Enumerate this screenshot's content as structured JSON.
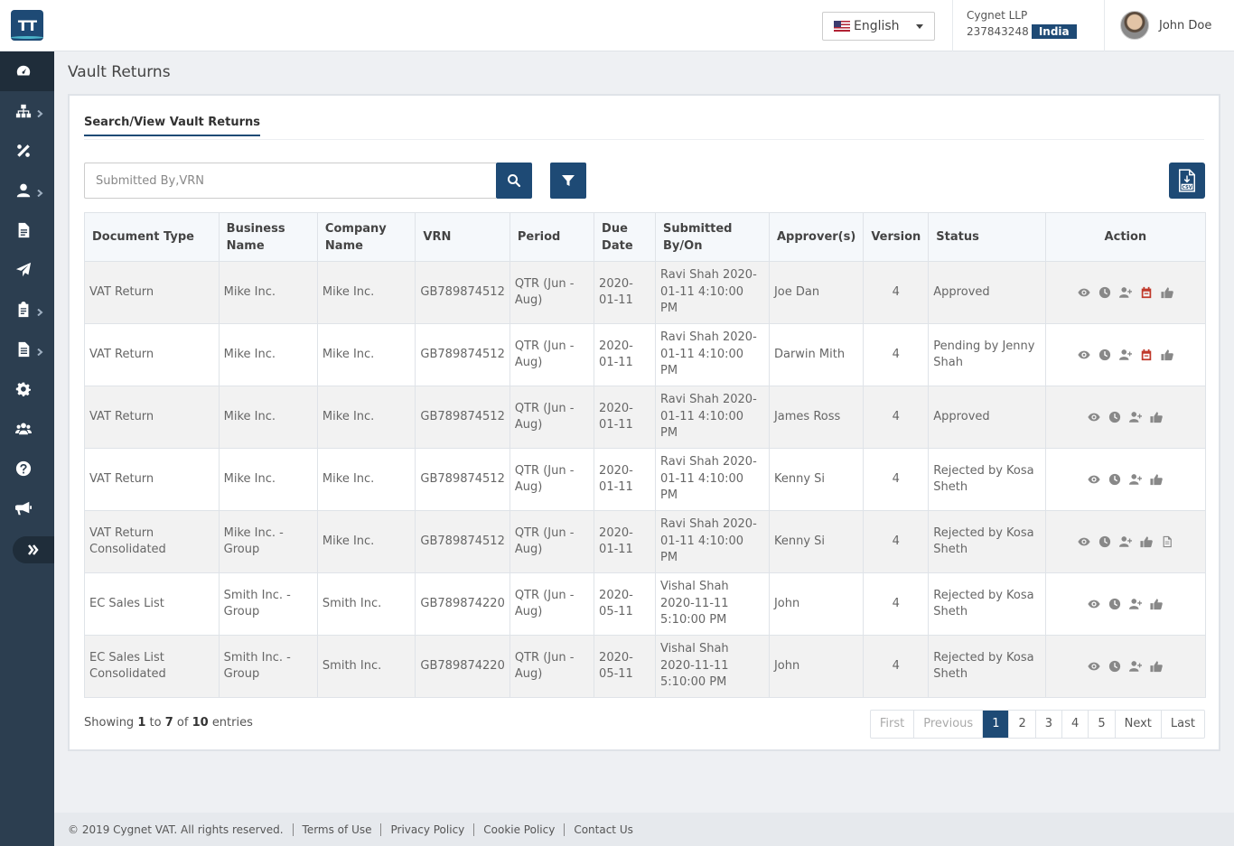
{
  "app": {
    "logo_text": "TT",
    "brand_color": "#1e4a75"
  },
  "sidebar": {
    "items": [
      {
        "icon": "dashboard-icon",
        "has_submenu": false,
        "active": true
      },
      {
        "icon": "sitemap-icon",
        "has_submenu": true
      },
      {
        "icon": "percent-icon",
        "has_submenu": false
      },
      {
        "icon": "user-icon",
        "has_submenu": true
      },
      {
        "icon": "document-icon",
        "has_submenu": false
      },
      {
        "icon": "paper-plane-icon",
        "has_submenu": false
      },
      {
        "icon": "clipboard-icon",
        "has_submenu": true
      },
      {
        "icon": "file-icon",
        "has_submenu": true
      },
      {
        "icon": "gear-icon",
        "has_submenu": false
      },
      {
        "icon": "users-icon",
        "has_submenu": false
      },
      {
        "icon": "help-icon",
        "has_submenu": false
      },
      {
        "icon": "megaphone-icon",
        "has_submenu": false
      }
    ]
  },
  "header": {
    "language": "English",
    "company_name": "Cygnet LLP",
    "company_vrn": "237843248",
    "country": "India",
    "user_name": "John Doe"
  },
  "page": {
    "title": "Vault Returns",
    "tab": "Search/View Vault Returns",
    "search_placeholder": "Submitted By,VRN"
  },
  "table": {
    "columns": [
      "Document Type",
      "Business Name",
      "Company Name",
      "VRN",
      "Period",
      "Due Date",
      "Submitted By/On",
      "Approver(s)",
      "Version",
      "Status",
      "Action"
    ],
    "rows": [
      {
        "doc_type": "VAT Return",
        "business": "Mike Inc.",
        "company": "Mike Inc.",
        "vrn": "GB789874512",
        "period": "QTR (Jun - Aug)",
        "due": "2020-01-11",
        "submitted": "Ravi Shah 2020-01-11 4:10:00 PM",
        "approver": "Joe Dan",
        "version": "4",
        "status": "Approved",
        "actions": [
          "view",
          "history",
          "assign",
          "calendar",
          "approve"
        ]
      },
      {
        "doc_type": "VAT Return",
        "business": "Mike Inc.",
        "company": "Mike Inc.",
        "vrn": "GB789874512",
        "period": "QTR (Jun - Aug)",
        "due": "2020-01-11",
        "submitted": "Ravi Shah 2020-01-11 4:10:00 PM",
        "approver": "Darwin Mith",
        "version": "4",
        "status": "Pending by Jenny Shah",
        "actions": [
          "view",
          "history",
          "assign",
          "calendar",
          "approve"
        ]
      },
      {
        "doc_type": "VAT Return",
        "business": "Mike Inc.",
        "company": "Mike Inc.",
        "vrn": "GB789874512",
        "period": "QTR (Jun - Aug)",
        "due": "2020-01-11",
        "submitted": "Ravi Shah 2020-01-11 4:10:00 PM",
        "approver": "James Ross",
        "version": "4",
        "status": "Approved",
        "actions": [
          "view",
          "history",
          "assign",
          "approve"
        ]
      },
      {
        "doc_type": "VAT Return",
        "business": "Mike Inc.",
        "company": "Mike Inc.",
        "vrn": "GB789874512",
        "period": "QTR (Jun - Aug)",
        "due": "2020-01-11",
        "submitted": "Ravi Shah 2020-01-11 4:10:00 PM",
        "approver": "Kenny Si",
        "version": "4",
        "status": "Rejected by Kosa Sheth",
        "actions": [
          "view",
          "history",
          "assign",
          "approve"
        ]
      },
      {
        "doc_type": "VAT Return Consolidated",
        "business": "Mike Inc. - Group",
        "company": "Mike Inc.",
        "vrn": "GB789874512",
        "period": "QTR (Jun - Aug)",
        "due": "2020-01-11",
        "submitted": "Ravi Shah 2020-01-11 4:10:00 PM",
        "approver": "Kenny Si",
        "version": "4",
        "status": "Rejected by Kosa Sheth",
        "actions": [
          "view",
          "history",
          "assign",
          "approve",
          "document"
        ]
      },
      {
        "doc_type": "EC Sales List",
        "business": "Smith Inc. - Group",
        "company": "Smith Inc.",
        "vrn": "GB789874220",
        "period": "QTR (Jun - Aug)",
        "due": "2020-05-11",
        "submitted": "Vishal Shah 2020-11-11 5:10:00 PM",
        "approver": "John",
        "version": "4",
        "status": "Rejected by Kosa Sheth",
        "actions": [
          "view",
          "history",
          "assign",
          "approve"
        ]
      },
      {
        "doc_type": "EC Sales List Consolidated",
        "business": "Smith Inc. - Group",
        "company": "Smith Inc.",
        "vrn": "GB789874220",
        "period": "QTR (Jun - Aug)",
        "due": "2020-05-11",
        "submitted": "Vishal Shah 2020-11-11 5:10:00 PM",
        "approver": "John",
        "version": "4",
        "status": "Rejected by Kosa Sheth",
        "actions": [
          "view",
          "history",
          "assign",
          "approve"
        ]
      }
    ]
  },
  "pagination": {
    "info_prefix": "Showing",
    "from": "1",
    "to_word": "to",
    "to": "7",
    "of_word": "of",
    "total": "10",
    "info_suffix": "entries",
    "first": "First",
    "previous": "Previous",
    "pages": [
      "1",
      "2",
      "3",
      "4",
      "5"
    ],
    "current": "1",
    "next": "Next",
    "last": "Last"
  },
  "footer": {
    "copyright": "© 2019 Cygnet VAT. All rights reserved.",
    "links": [
      "Terms of Use",
      "Privacy Policy",
      "Cookie Policy",
      "Contact Us"
    ]
  }
}
